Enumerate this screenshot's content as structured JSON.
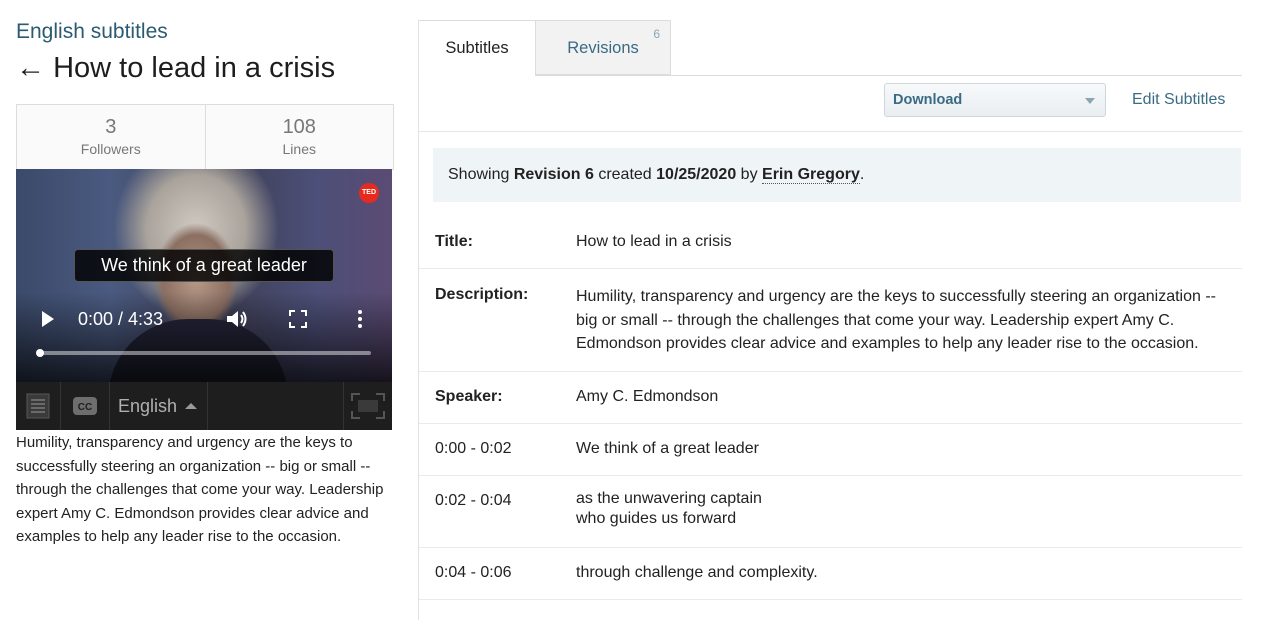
{
  "header": {
    "language_title": "English subtitles",
    "back_arrow": "←",
    "video_title": "How to lead in a crisis"
  },
  "stats": {
    "followers_count": "3",
    "followers_label": "Followers",
    "lines_count": "108",
    "lines_label": "Lines"
  },
  "player": {
    "badge": "TED",
    "caption": "We think of a great leader",
    "time": "0:00 / 4:33",
    "progress": 0,
    "language": "English",
    "icons": [
      "play-icon",
      "volume-icon",
      "fullscreen-icon",
      "more-vertical-icon",
      "transcript-icon",
      "closed-captions-icon",
      "expand-icon"
    ]
  },
  "description_left": "Humility, transparency and urgency are the keys to successfully steering an organization -- big or small -- through the challenges that come your way. Leadership expert Amy C. Edmondson provides clear advice and examples to help any leader rise to the occasion.",
  "tabs": {
    "subtitles": "Subtitles",
    "revisions": "Revisions",
    "revisions_count": "6"
  },
  "toolbar": {
    "download": "Download",
    "edit": "Edit Subtitles"
  },
  "revision": {
    "prefix": "Showing",
    "name": "Revision 6",
    "created": "created",
    "date": "10/25/2020",
    "by": "by",
    "author": "Erin Gregory",
    "suffix": "."
  },
  "meta": {
    "title_label": "Title:",
    "title_value": "How to lead in a crisis",
    "description_label": "Description:",
    "description_value": "Humility, transparency and urgency are the keys to successfully steering an organization -- big or small -- through the challenges that come your way. Leadership expert Amy C. Edmondson provides clear advice and examples to help any leader rise to the occasion.",
    "speaker_label": "Speaker:",
    "speaker_value": "Amy C. Edmondson"
  },
  "lines": [
    {
      "time": "0:00 - 0:02",
      "text": "We think of a great leader"
    },
    {
      "time": "0:02 - 0:04",
      "text1": "as the unwavering captain",
      "text2": "who guides us forward"
    },
    {
      "time": "0:04 - 0:06",
      "text": "through challenge and complexity."
    }
  ],
  "colors": {
    "link": "#3a6b84",
    "title": "#2b5b72",
    "ted_red": "#e62b1e",
    "banner_bg": "#eff4f7"
  }
}
